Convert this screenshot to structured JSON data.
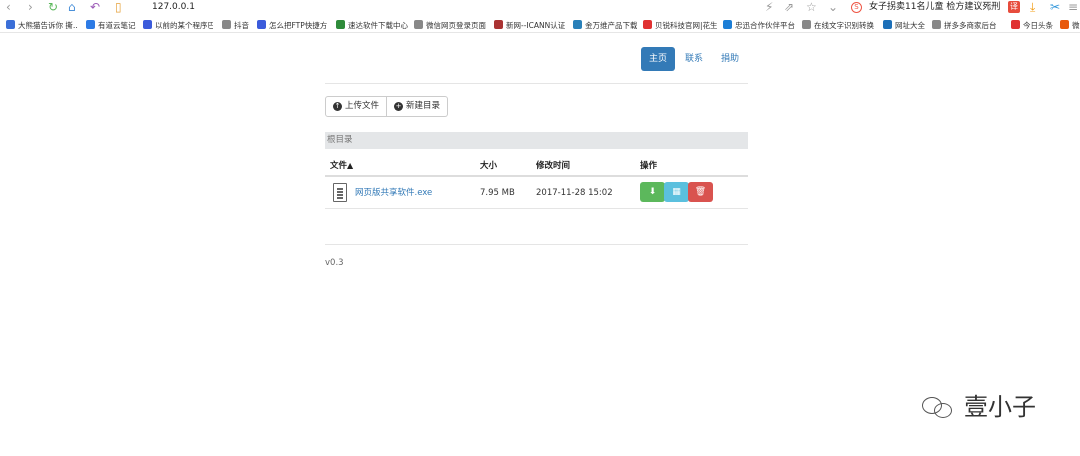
{
  "browser": {
    "url": "127.0.0.1",
    "news_text": "女子拐卖11名儿童 检方建议死刑",
    "bookmarks": [
      "大熊猫告诉你 撕…",
      "有道云笔记",
      "以前的某个程序巴",
      "抖音",
      "怎么把FTP快捷方",
      "速达软件下载中心",
      "微信网页登录页面",
      "新网--ICANN认证",
      "金万维产品下载",
      "贝锐科技官网|花生",
      "忠迅合作伙伴平台",
      "在线文字识别转换",
      "网址大全",
      "拼多多商家后台",
      "今日头条",
      "微"
    ]
  },
  "nav": {
    "home": "主页",
    "contact": "联系",
    "donate": "捐助"
  },
  "toolbar": {
    "upload": "上传文件",
    "new_dir": "新建目录"
  },
  "breadcrumb": "根目录",
  "table": {
    "headers": {
      "file": "文件",
      "size": "大小",
      "mtime": "修改时间",
      "ops": "操作"
    },
    "rows": [
      {
        "name": "网页版共享软件.exe",
        "size": "7.95 MB",
        "mtime": "2017-11-28 15:02"
      }
    ]
  },
  "footer": {
    "version": "v0.3"
  },
  "watermark": {
    "text": "壹小子"
  },
  "colors": {
    "primary": "#337ab7",
    "success": "#5cb85c",
    "info": "#5bc0de",
    "danger": "#d9534f"
  }
}
